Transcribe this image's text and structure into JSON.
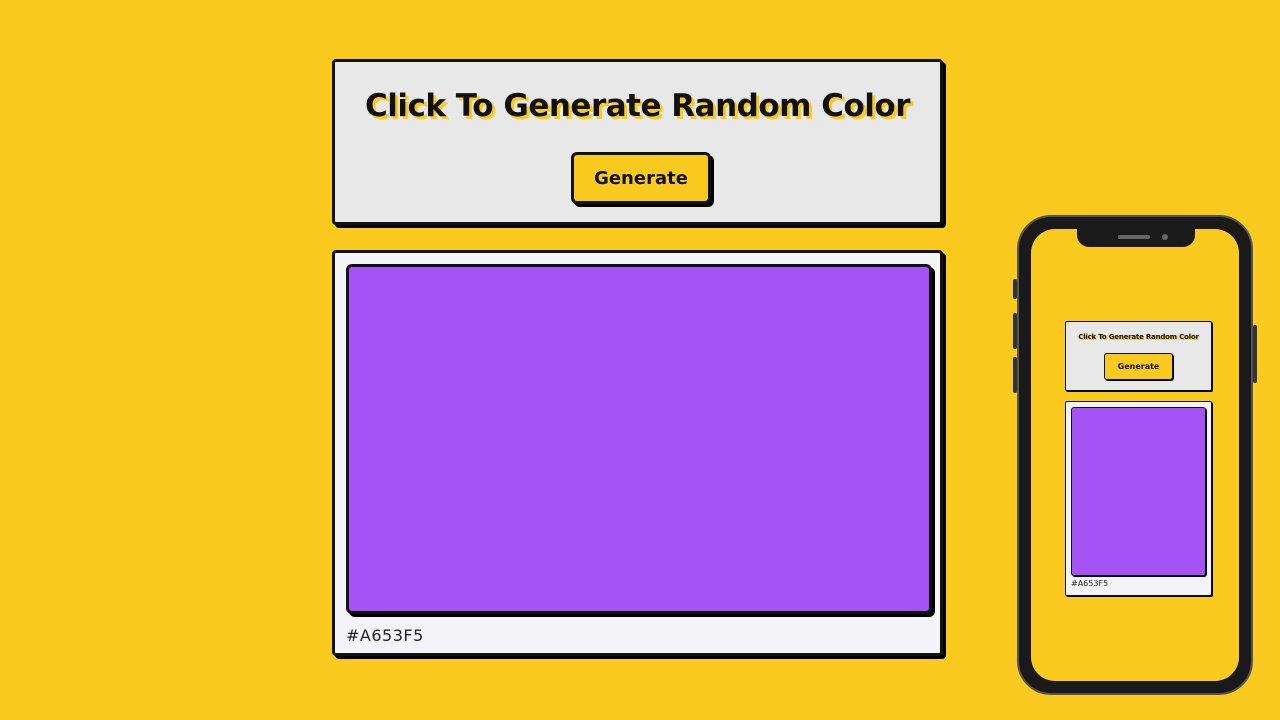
{
  "colors": {
    "background": "#FACA1F",
    "card": "#E8E8E8",
    "swatch_card": "#F4F4F8",
    "current": "#A653F5"
  },
  "header": {
    "title": "Click To Generate Random Color",
    "button_label": "Generate"
  },
  "color_panel": {
    "hex": "#A653F5"
  },
  "mobile_preview": {
    "title": "Click To Generate Random Color",
    "button_label": "Generate",
    "hex": "#A653F5"
  }
}
